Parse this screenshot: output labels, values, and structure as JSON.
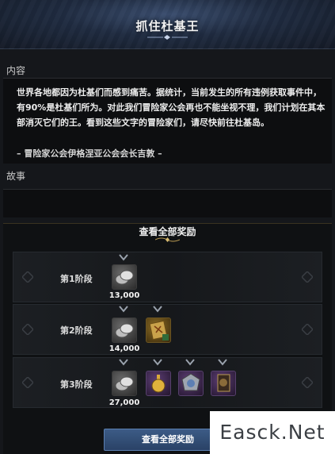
{
  "header": {
    "title": "抓住杜基王"
  },
  "content": {
    "label": "内容",
    "text": "世界各地都因为杜基们而感到痛苦。据统计，当前发生的所有违例获取事件中，有90%是杜基们所为。对此我们冒险家公会再也不能坐视不理，我们计划在其本部消灭它们的王。看到这些文字的冒险家们，请尽快前往杜基岛。",
    "signature": "– 冒险家公会伊格涅亚公会会长吉敦 –"
  },
  "story": {
    "label": "故事"
  },
  "rewards": {
    "title": "查看全部奖励",
    "stages": [
      {
        "label": "第1阶段",
        "coin_amount": "13,000",
        "items": [
          "silver-coin"
        ]
      },
      {
        "label": "第2阶段",
        "coin_amount": "14,000",
        "items": [
          "silver-coin",
          "treasure-map"
        ]
      },
      {
        "label": "第3阶段",
        "coin_amount": "27,000",
        "items": [
          "silver-coin",
          "gold-potion",
          "silver-emblem",
          "card-chest"
        ]
      }
    ]
  },
  "footer": {
    "button_label": "查看全部奖励"
  },
  "watermark": "Easck.Net",
  "colors": {
    "accent_blue": "#3c5b86",
    "gold_ornament": "#b99a52",
    "panel": "#0d0e10"
  }
}
